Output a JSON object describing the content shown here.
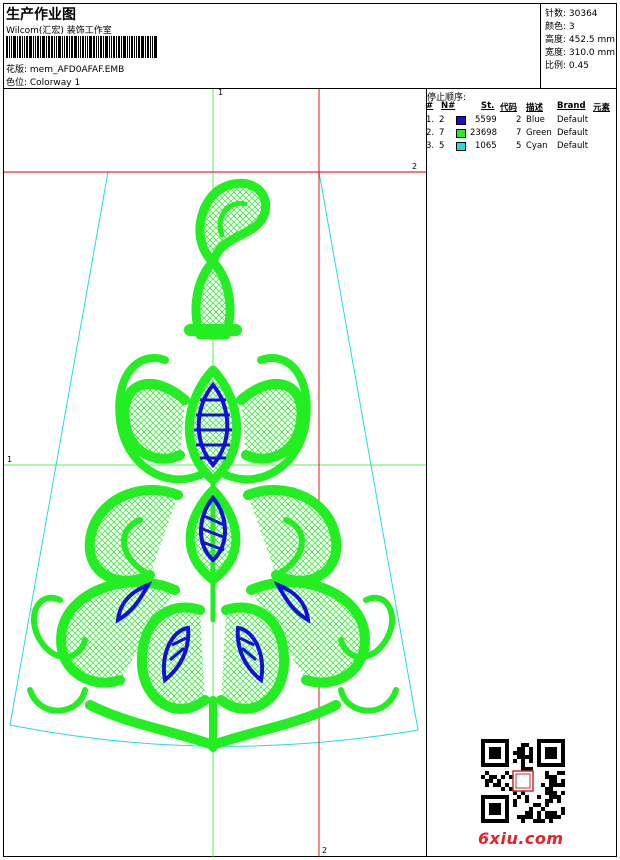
{
  "header": {
    "title": "生产作业图",
    "company": "Wilcom(汇宏) 装饰工作室",
    "design_label": "花版: mem_AFD0AFAF.EMB",
    "colorway_label": "色位: Colorway 1"
  },
  "stats": [
    {
      "label": "针数",
      "value": "30364",
      "text": "针数: 30364"
    },
    {
      "label": "颜色",
      "value": "3",
      "text": "颜色: 3"
    },
    {
      "label": "高度",
      "value": "452.5 mm",
      "text": "高度: 452.5 mm"
    },
    {
      "label": "宽度",
      "value": "310.0 mm",
      "text": "宽度: 310.0 mm"
    },
    {
      "label": "比例",
      "value": "0.45",
      "text": "比例: 0.45"
    }
  ],
  "stop_sequence": {
    "title": "停止顺序:",
    "columns": [
      "#",
      "N#",
      "St.",
      "代码",
      "描述",
      "Brand",
      "元素"
    ],
    "rows": [
      {
        "idx": "1.",
        "n": "2",
        "stitches": "5599",
        "code": "2",
        "desc": "Blue",
        "brand": "Default",
        "color": "#1010dd"
      },
      {
        "idx": "2.",
        "n": "7",
        "stitches": "23698",
        "code": "7",
        "desc": "Green",
        "brand": "Default",
        "color": "#22ee22"
      },
      {
        "idx": "3.",
        "n": "5",
        "stitches": "1065",
        "code": "5",
        "desc": "Cyan",
        "brand": "Default",
        "color": "#22dddd"
      }
    ]
  },
  "guides": {
    "green_top_label": "1",
    "green_left_label": "1",
    "red_right_label": "2",
    "red_bottom_label": "2"
  },
  "watermark": "6xiu.com",
  "colors": {
    "green": "#22ee22",
    "blue": "#1010dd",
    "cyan": "#22dddd",
    "red": "#dd0000"
  }
}
